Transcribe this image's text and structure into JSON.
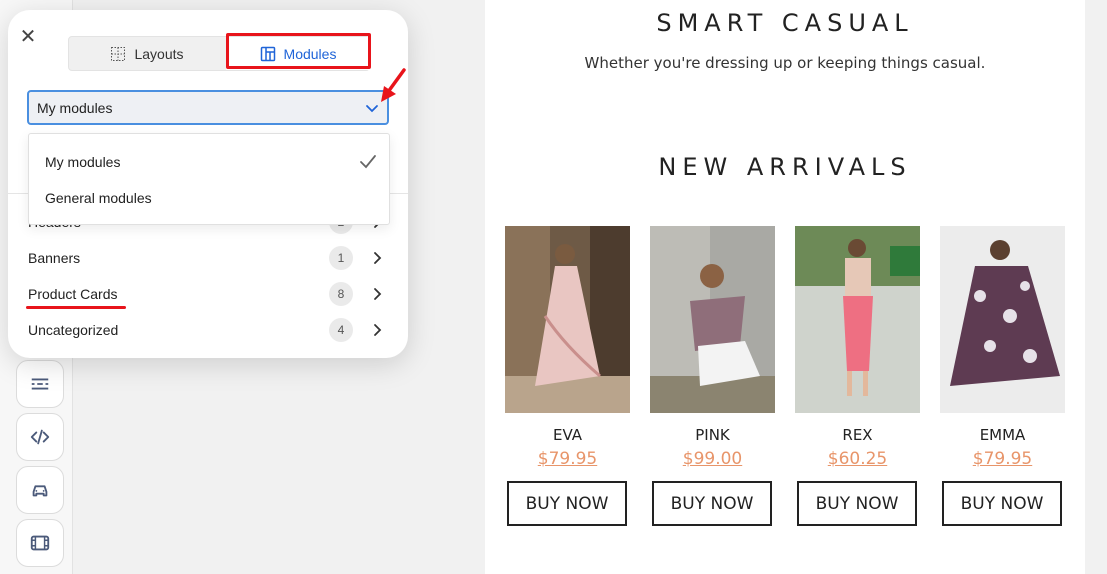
{
  "panel": {
    "tabs": [
      {
        "label": "Layouts",
        "icon": "grid-dotted-icon",
        "active": false
      },
      {
        "label": "Modules",
        "icon": "modules-icon",
        "active": true
      }
    ],
    "select": {
      "value": "My modules",
      "options": [
        "My modules",
        "General modules"
      ],
      "selected_index": 0
    },
    "categories": [
      {
        "label": "Headers",
        "count": "2"
      },
      {
        "label": "Banners",
        "count": "1"
      },
      {
        "label": "Product Cards",
        "count": "8"
      },
      {
        "label": "Uncategorized",
        "count": "4"
      }
    ],
    "annotation_color": "#e8141b",
    "accent_color": "#1f64d8"
  },
  "toolbar": {
    "icons": [
      "divider-icon",
      "code-icon",
      "car-icon",
      "video-icon"
    ]
  },
  "email": {
    "heading_1": "SMART CASUAL",
    "subtext": "Whether you're dressing up or keeping things casual.",
    "heading_2": "NEW ARRIVALS",
    "products": [
      {
        "name": "EVA",
        "price": "$79.95",
        "button": "BUY NOW"
      },
      {
        "name": "PINK",
        "price": "$99.00",
        "button": "BUY NOW"
      },
      {
        "name": "REX",
        "price": "$60.25",
        "button": "BUY NOW"
      },
      {
        "name": "EMMA",
        "price": "$79.95",
        "button": "BUY NOW"
      }
    ],
    "price_color": "#e8956a"
  }
}
